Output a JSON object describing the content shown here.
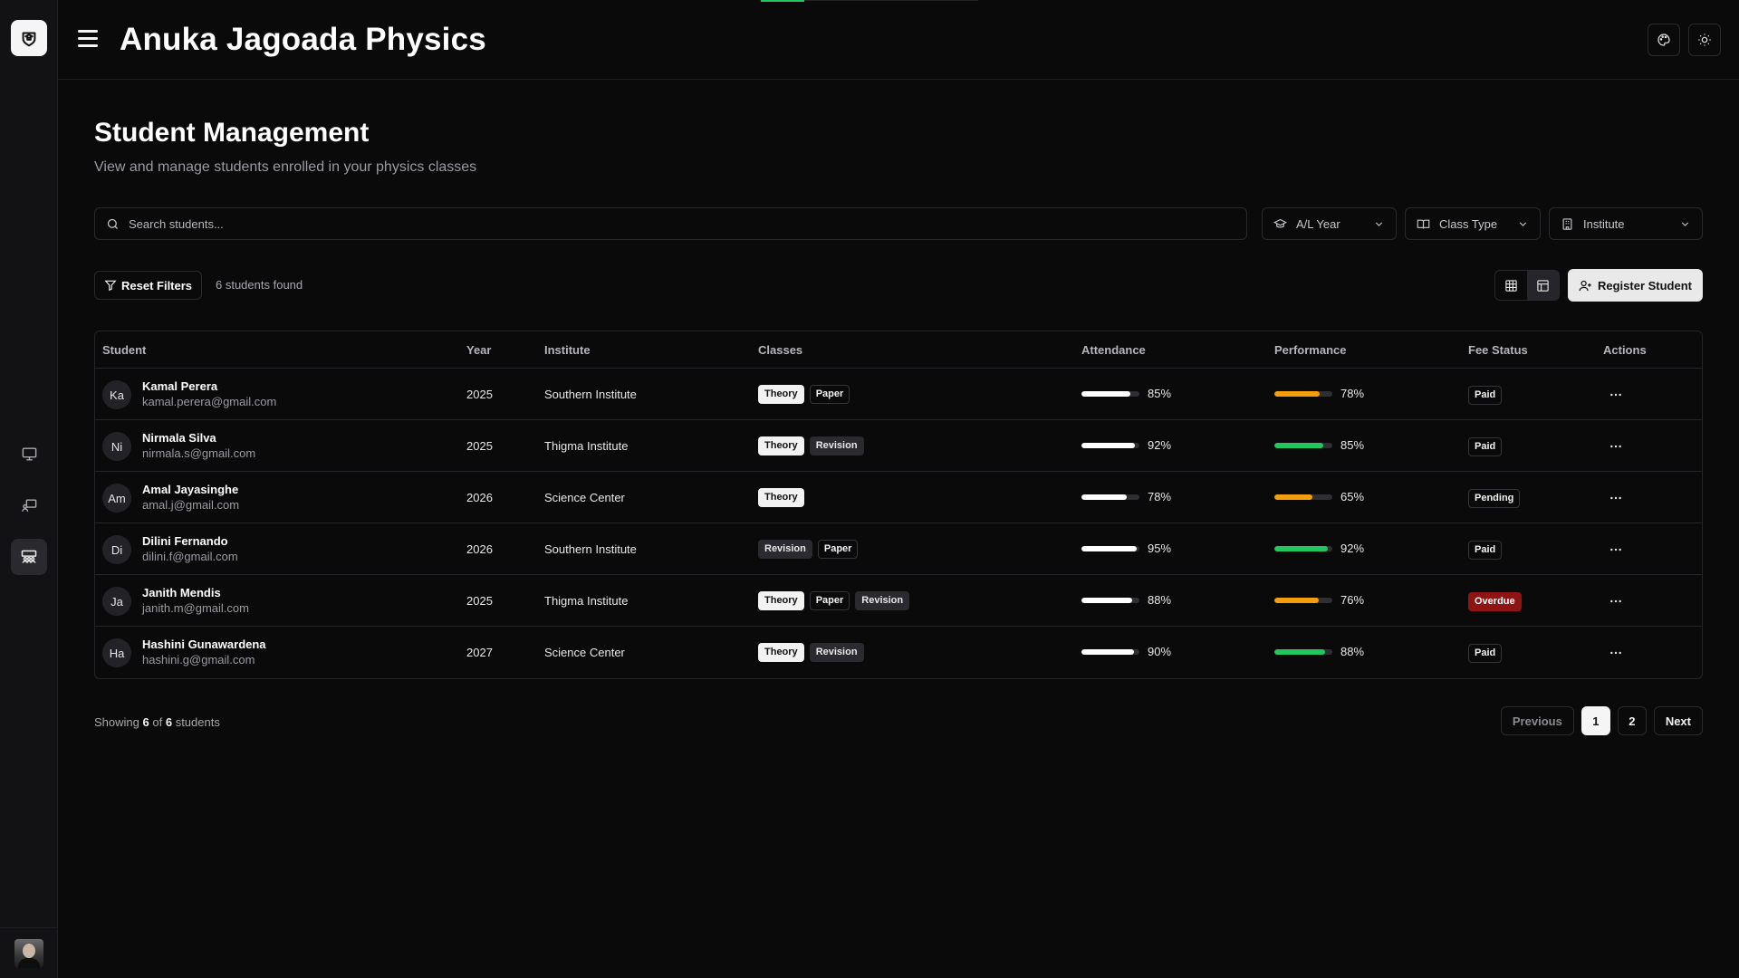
{
  "app": {
    "title": "Anuka Jagoada Physics"
  },
  "colors": {
    "accent_green": "#22c55e",
    "warning_orange": "#f59e0b",
    "overdue_red": "#8f1515",
    "bar_white": "#ffffff"
  },
  "sidebar": {
    "logo_icon": "graduation-shield-icon",
    "items": [
      {
        "icon": "monitor-icon"
      },
      {
        "icon": "presentation-icon"
      },
      {
        "icon": "students-icon",
        "active": true
      }
    ]
  },
  "header": {
    "icons": [
      "palette-icon",
      "sun-icon"
    ]
  },
  "page": {
    "title": "Student Management",
    "subtitle": "View and manage students enrolled in your physics classes"
  },
  "search": {
    "placeholder": "Search students..."
  },
  "filters": {
    "year": "A/L Year",
    "class_type": "Class Type",
    "institute": "Institute"
  },
  "toolbar": {
    "reset_label": "Reset Filters",
    "found_text": "6 students found",
    "register_label": "Register Student"
  },
  "table": {
    "headers": [
      "Student",
      "Year",
      "Institute",
      "Classes",
      "Attendance",
      "Performance",
      "Fee Status",
      "Actions"
    ],
    "rows": [
      {
        "initials": "Ka",
        "name": "Kamal Perera",
        "email": "kamal.perera@gmail.com",
        "year": "2025",
        "institute": "Southern Institute",
        "classes": [
          "Theory",
          "Paper"
        ],
        "attendance": 85,
        "attendance_label": "85%",
        "performance": 78,
        "performance_label": "78%",
        "fee": "Paid"
      },
      {
        "initials": "Ni",
        "name": "Nirmala Silva",
        "email": "nirmala.s@gmail.com",
        "year": "2025",
        "institute": "Thigma Institute",
        "classes": [
          "Theory",
          "Revision"
        ],
        "attendance": 92,
        "attendance_label": "92%",
        "performance": 85,
        "performance_label": "85%",
        "fee": "Paid"
      },
      {
        "initials": "Am",
        "name": "Amal Jayasinghe",
        "email": "amal.j@gmail.com",
        "year": "2026",
        "institute": "Science Center",
        "classes": [
          "Theory"
        ],
        "attendance": 78,
        "attendance_label": "78%",
        "performance": 65,
        "performance_label": "65%",
        "fee": "Pending"
      },
      {
        "initials": "Di",
        "name": "Dilini Fernando",
        "email": "dilini.f@gmail.com",
        "year": "2026",
        "institute": "Southern Institute",
        "classes": [
          "Revision",
          "Paper"
        ],
        "attendance": 95,
        "attendance_label": "95%",
        "performance": 92,
        "performance_label": "92%",
        "fee": "Paid"
      },
      {
        "initials": "Ja",
        "name": "Janith Mendis",
        "email": "janith.m@gmail.com",
        "year": "2025",
        "institute": "Thigma Institute",
        "classes": [
          "Theory",
          "Paper",
          "Revision"
        ],
        "attendance": 88,
        "attendance_label": "88%",
        "performance": 76,
        "performance_label": "76%",
        "fee": "Overdue"
      },
      {
        "initials": "Ha",
        "name": "Hashini Gunawardena",
        "email": "hashini.g@gmail.com",
        "year": "2027",
        "institute": "Science Center",
        "classes": [
          "Theory",
          "Revision"
        ],
        "attendance": 90,
        "attendance_label": "90%",
        "performance": 88,
        "performance_label": "88%",
        "fee": "Paid"
      }
    ]
  },
  "footer": {
    "showing_prefix": "Showing",
    "showing_count": "6",
    "showing_of": "of",
    "showing_total": "6",
    "showing_suffix": "students",
    "prev_label": "Previous",
    "pages": [
      "1",
      "2"
    ],
    "current_page": "1",
    "next_label": "Next"
  }
}
